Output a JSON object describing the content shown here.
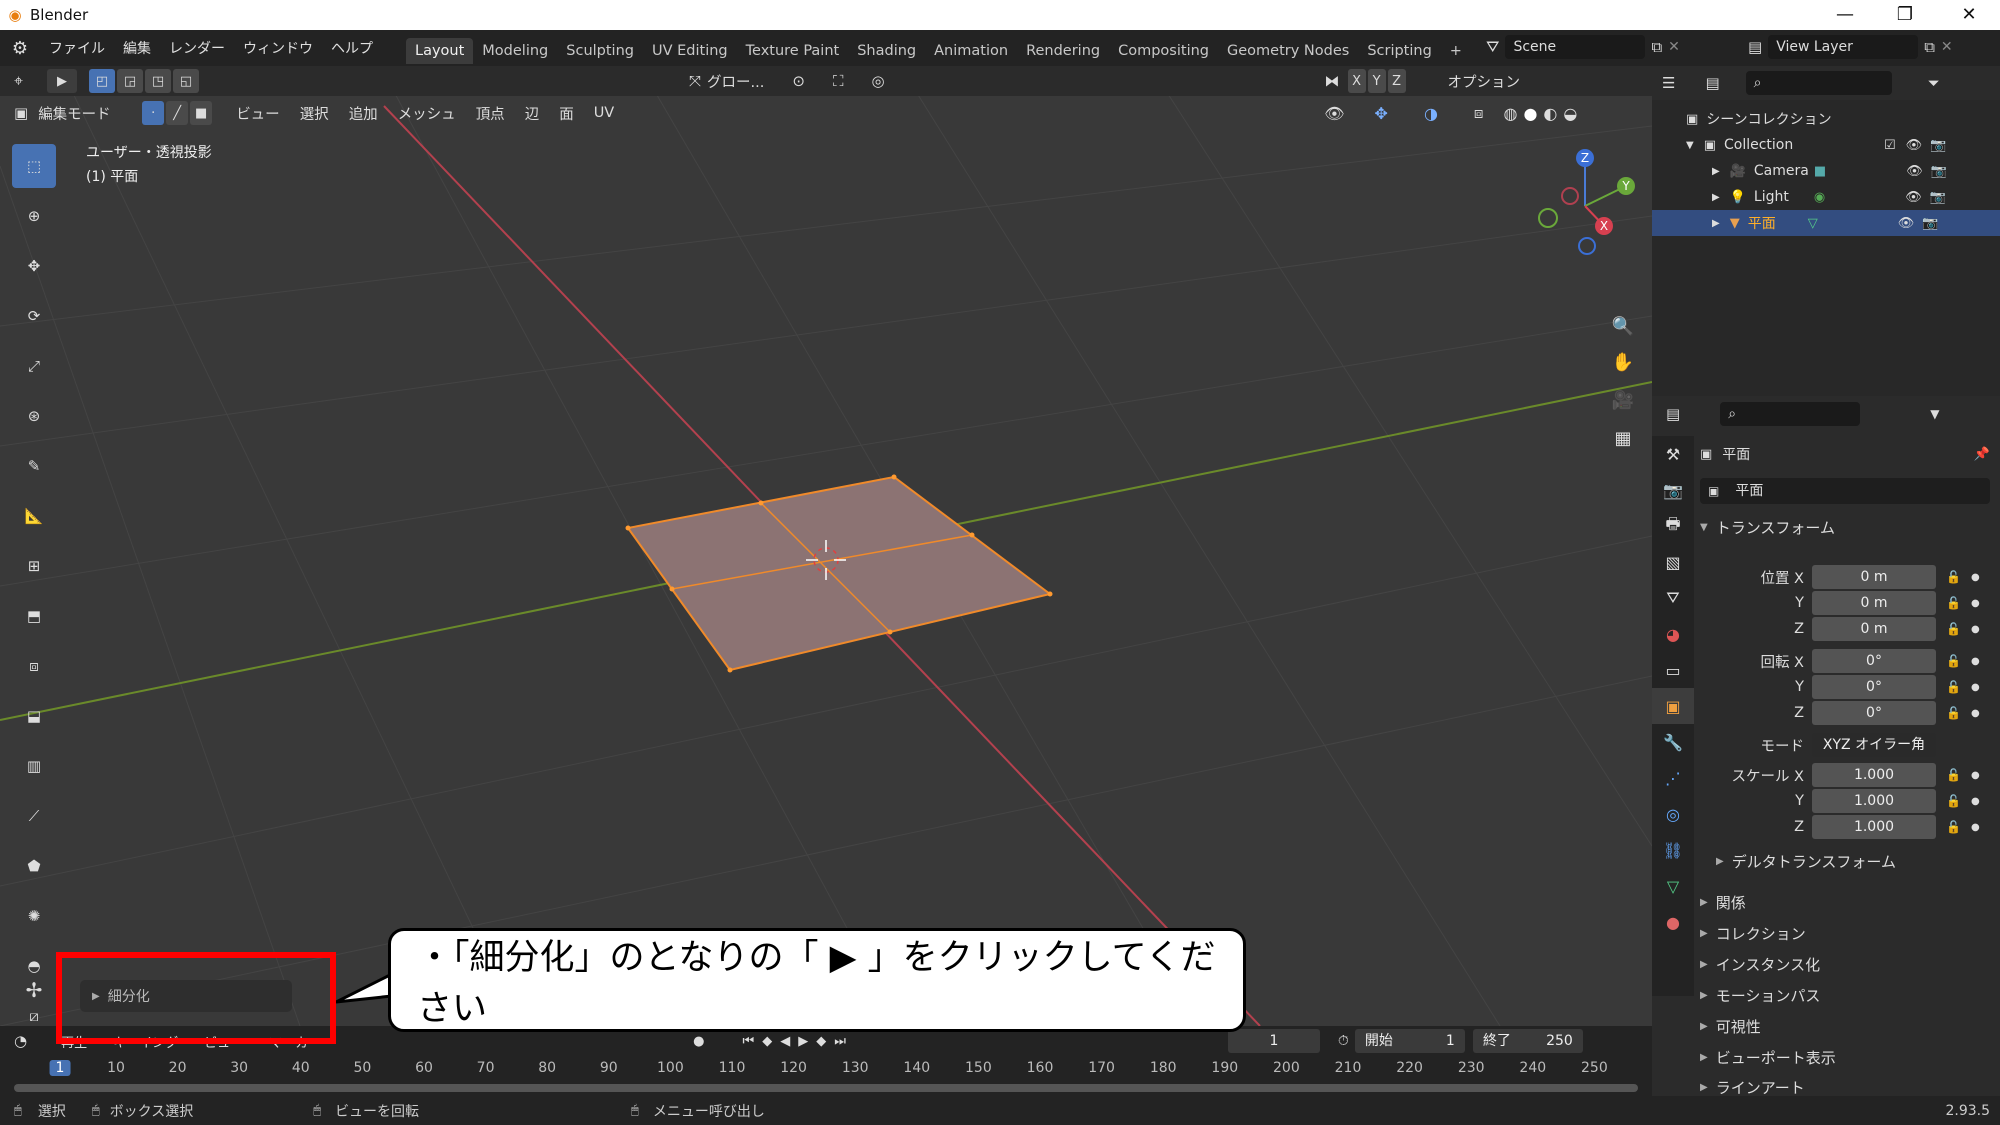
{
  "window": {
    "app_title": "Blender",
    "minimize": "—",
    "maximize": "❐",
    "close": "✕"
  },
  "menu": {
    "items": [
      "ファイル",
      "編集",
      "レンダー",
      "ウィンドウ",
      "ヘルプ"
    ]
  },
  "workspaces": [
    "Layout",
    "Modeling",
    "Sculpting",
    "UV Editing",
    "Texture Paint",
    "Shading",
    "Animation",
    "Rendering",
    "Compositing",
    "Geometry Nodes",
    "Scripting"
  ],
  "scene": {
    "name": "Scene",
    "view_layer": "View Layer",
    "add_tab": "+"
  },
  "viewport_header": {
    "mode": "編集モード",
    "menus": [
      "ビュー",
      "選択",
      "追加",
      "メッシュ",
      "頂点",
      "辺",
      "面",
      "UV"
    ],
    "transform_orientation": "グロー...",
    "axes": [
      "X",
      "Y",
      "Z"
    ],
    "options": "オプション"
  },
  "viewport": {
    "view_name": "ユーザー・透視投影",
    "object_name": "(1) 平面",
    "gizmo_x": "X",
    "gizmo_y": "Y",
    "gizmo_z": "Z"
  },
  "operator_panel": {
    "label": "細分化"
  },
  "callout": {
    "text": "・「細分化」のとなりの「 ▶ 」をクリックしてください"
  },
  "outliner": {
    "scene_collection": "シーンコレクション",
    "collection": "Collection",
    "items": [
      "Camera",
      "Light",
      "平面"
    ]
  },
  "properties": {
    "object_name": "平面",
    "data_name": "平面",
    "transform_title": "トランスフォーム",
    "location_label": "位置 X",
    "rotation_label": "回転 X",
    "scale_label": "スケール X",
    "y": "Y",
    "z": "Z",
    "location": [
      "0 m",
      "0 m",
      "0 m"
    ],
    "rotation": [
      "0°",
      "0°",
      "0°"
    ],
    "mode_label": "モード",
    "mode_value": "XYZ オイラー角",
    "scale": [
      "1.000",
      "1.000",
      "1.000"
    ],
    "delta": "デルタトランスフォーム",
    "sections": [
      "関係",
      "コレクション",
      "インスタンス化",
      "モーションパス",
      "可視性",
      "ビューポート表示",
      "ラインアート"
    ]
  },
  "timeline": {
    "menus": [
      "再生",
      "キーイング",
      "ビュー",
      "マーカー"
    ],
    "current_frame": "1",
    "start_label": "開始",
    "start": "1",
    "end_label": "終了",
    "end": "250",
    "ticks": [
      "1",
      "10",
      "20",
      "30",
      "40",
      "50",
      "60",
      "70",
      "80",
      "90",
      "100",
      "110",
      "120",
      "130",
      "140",
      "150",
      "160",
      "170",
      "180",
      "190",
      "200",
      "210",
      "220",
      "230",
      "240",
      "250"
    ]
  },
  "statusbar": {
    "select": "選択",
    "box_select": "ボックス選択",
    "rotate_view": "ビューを回転",
    "call_menu": "メニュー呼び出し",
    "version": "2.93.5"
  },
  "colors": {
    "accent": "#4772b3",
    "selection": "#e87d0d",
    "callout_border": "#ff0000"
  }
}
